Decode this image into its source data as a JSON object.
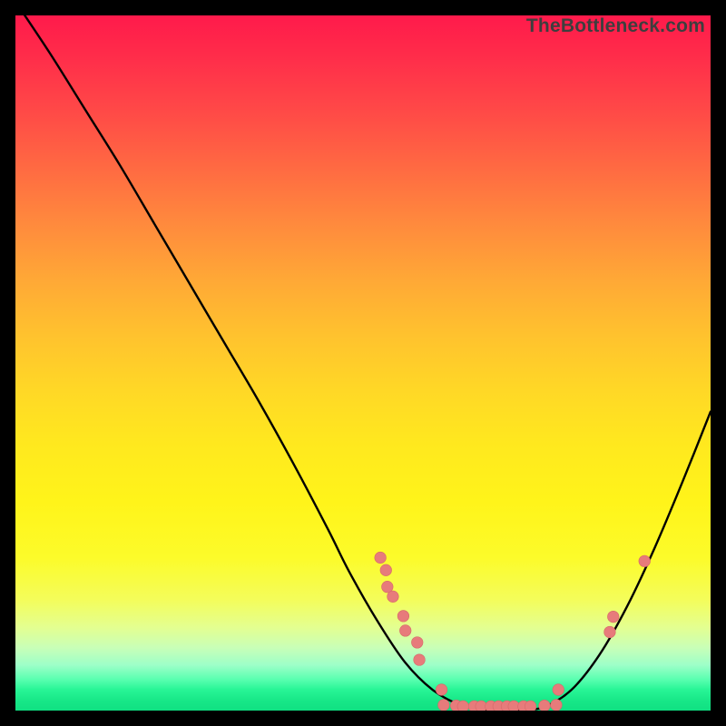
{
  "watermark": "TheBottleneck.com",
  "chart_data": {
    "type": "line",
    "title": "",
    "xlabel": "",
    "ylabel": "",
    "xlim": [
      0,
      100
    ],
    "ylim": [
      0,
      100
    ],
    "series": [
      {
        "name": "curve",
        "x": [
          0,
          5,
          10,
          15,
          20,
          25,
          30,
          35,
          40,
          45,
          48,
          52,
          56,
          60,
          64,
          68,
          72,
          76,
          80,
          84,
          88,
          92,
          96,
          100
        ],
        "y": [
          102,
          94.5,
          86.5,
          78.5,
          70,
          61.5,
          53,
          44.5,
          35.5,
          26,
          20,
          13,
          7,
          3,
          0.8,
          0,
          0,
          0.5,
          3,
          8,
          15,
          23.5,
          33,
          43
        ]
      }
    ],
    "markers": [
      {
        "x": 52.5,
        "y": 22.0
      },
      {
        "x": 53.3,
        "y": 20.2
      },
      {
        "x": 53.5,
        "y": 17.8
      },
      {
        "x": 54.3,
        "y": 16.4
      },
      {
        "x": 55.8,
        "y": 13.6
      },
      {
        "x": 56.1,
        "y": 11.5
      },
      {
        "x": 57.8,
        "y": 9.8
      },
      {
        "x": 58.1,
        "y": 7.3
      },
      {
        "x": 61.3,
        "y": 3.0
      },
      {
        "x": 61.6,
        "y": 0.8
      },
      {
        "x": 63.4,
        "y": 0.7
      },
      {
        "x": 64.4,
        "y": 0.6
      },
      {
        "x": 66.0,
        "y": 0.6
      },
      {
        "x": 67.0,
        "y": 0.6
      },
      {
        "x": 68.4,
        "y": 0.6
      },
      {
        "x": 69.5,
        "y": 0.6
      },
      {
        "x": 70.7,
        "y": 0.6
      },
      {
        "x": 71.7,
        "y": 0.6
      },
      {
        "x": 73.1,
        "y": 0.6
      },
      {
        "x": 74.1,
        "y": 0.6
      },
      {
        "x": 76.1,
        "y": 0.7
      },
      {
        "x": 77.8,
        "y": 0.8
      },
      {
        "x": 78.1,
        "y": 3.0
      },
      {
        "x": 85.5,
        "y": 11.3
      },
      {
        "x": 86.0,
        "y": 13.5
      },
      {
        "x": 90.5,
        "y": 21.5
      }
    ],
    "colors": {
      "curve": "#000000",
      "marker_fill": "#e77b7b",
      "marker_stroke": "#d66868"
    }
  }
}
